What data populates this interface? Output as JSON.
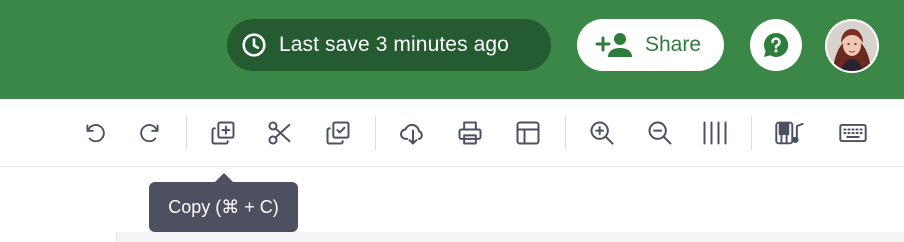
{
  "header": {
    "save_status": "Last save 3 minutes ago",
    "share_label": "Share",
    "help_icon": "help-question-icon",
    "avatar_icon": "user-avatar"
  },
  "toolbar": {
    "items": [
      {
        "name": "undo",
        "icon": "undo-icon"
      },
      {
        "name": "redo",
        "icon": "redo-icon"
      },
      {
        "name": "copy",
        "icon": "copy-icon"
      },
      {
        "name": "cut",
        "icon": "scissors-icon"
      },
      {
        "name": "paste",
        "icon": "paste-icon"
      },
      {
        "name": "download",
        "icon": "cloud-download-icon"
      },
      {
        "name": "print",
        "icon": "printer-icon"
      },
      {
        "name": "layout",
        "icon": "layout-icon"
      },
      {
        "name": "zoom-in",
        "icon": "zoom-in-icon"
      },
      {
        "name": "zoom-out",
        "icon": "zoom-out-icon"
      },
      {
        "name": "columns",
        "icon": "columns-icon"
      },
      {
        "name": "piano",
        "icon": "piano-music-icon"
      },
      {
        "name": "keyboard",
        "icon": "keyboard-icon"
      }
    ]
  },
  "tooltip": {
    "text": "Copy (⌘ + C)"
  },
  "colors": {
    "header_bg": "#3a8748",
    "save_pill_bg": "#245b31",
    "accent_green": "#2e7d3d",
    "icon_stroke": "#4b5163",
    "tooltip_bg": "#4c5060"
  }
}
